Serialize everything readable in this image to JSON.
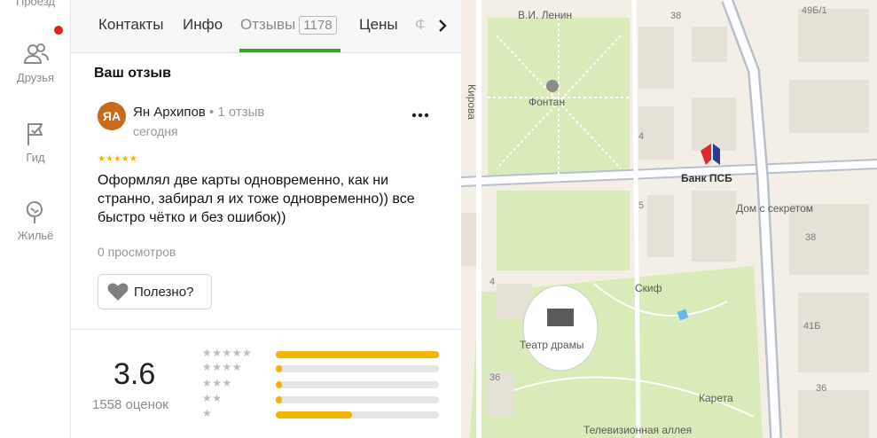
{
  "rail": {
    "top_label": "Проезд",
    "friends_label": "Друзья",
    "guide_label": "Гид",
    "housing_label": "Жильё"
  },
  "tabs": {
    "contacts": "Контакты",
    "info": "Инфо",
    "reviews": "Отзывы",
    "reviews_count": "1178",
    "prices": "Цены",
    "next_partial": "Ф"
  },
  "review": {
    "section_title": "Ваш отзыв",
    "avatar_initials": "ЯА",
    "author": "Ян Архипов",
    "separator": " • ",
    "author_reviews": "1 отзыв",
    "date": "сегодня",
    "stars": "★★★★★",
    "text": "Оформлял две карты одновременно, как ни странно, забирал я их тоже одновременно)) все быстро чётко и без ошибок))",
    "views": "0 просмотров",
    "useful_label": "Полезно?"
  },
  "summary": {
    "rating": "3.6",
    "ratings_count": "1558 оценок",
    "distribution": [
      {
        "stars": "★★★★★",
        "share": 1.0
      },
      {
        "stars": "★★★★",
        "share": 0.04
      },
      {
        "stars": "★★★",
        "share": 0.04
      },
      {
        "stars": "★★",
        "share": 0.04
      },
      {
        "stars": "★",
        "share": 0.47
      }
    ]
  },
  "map": {
    "labels": {
      "lenin": "В.И. Ленин",
      "fountain": "Фонтан",
      "kirova": "Кирова",
      "bank": "Банк ПСБ",
      "secret_house": "Дом с секретом",
      "skif": "Скиф",
      "theater": "Театр драмы",
      "carriage": "Карета",
      "tv_alley": "Телевизионная аллея"
    },
    "numbers": [
      "38",
      "49Б/1",
      "4",
      "5",
      "4",
      "36",
      "41Б",
      "36",
      "38"
    ],
    "colors": {
      "park": "#d8ebb8",
      "road": "#ffffff",
      "highway": "#b8c0cc",
      "building": "#e6e1d6",
      "bank_red": "#e0282e",
      "bank_blue": "#2d3b8c"
    }
  }
}
